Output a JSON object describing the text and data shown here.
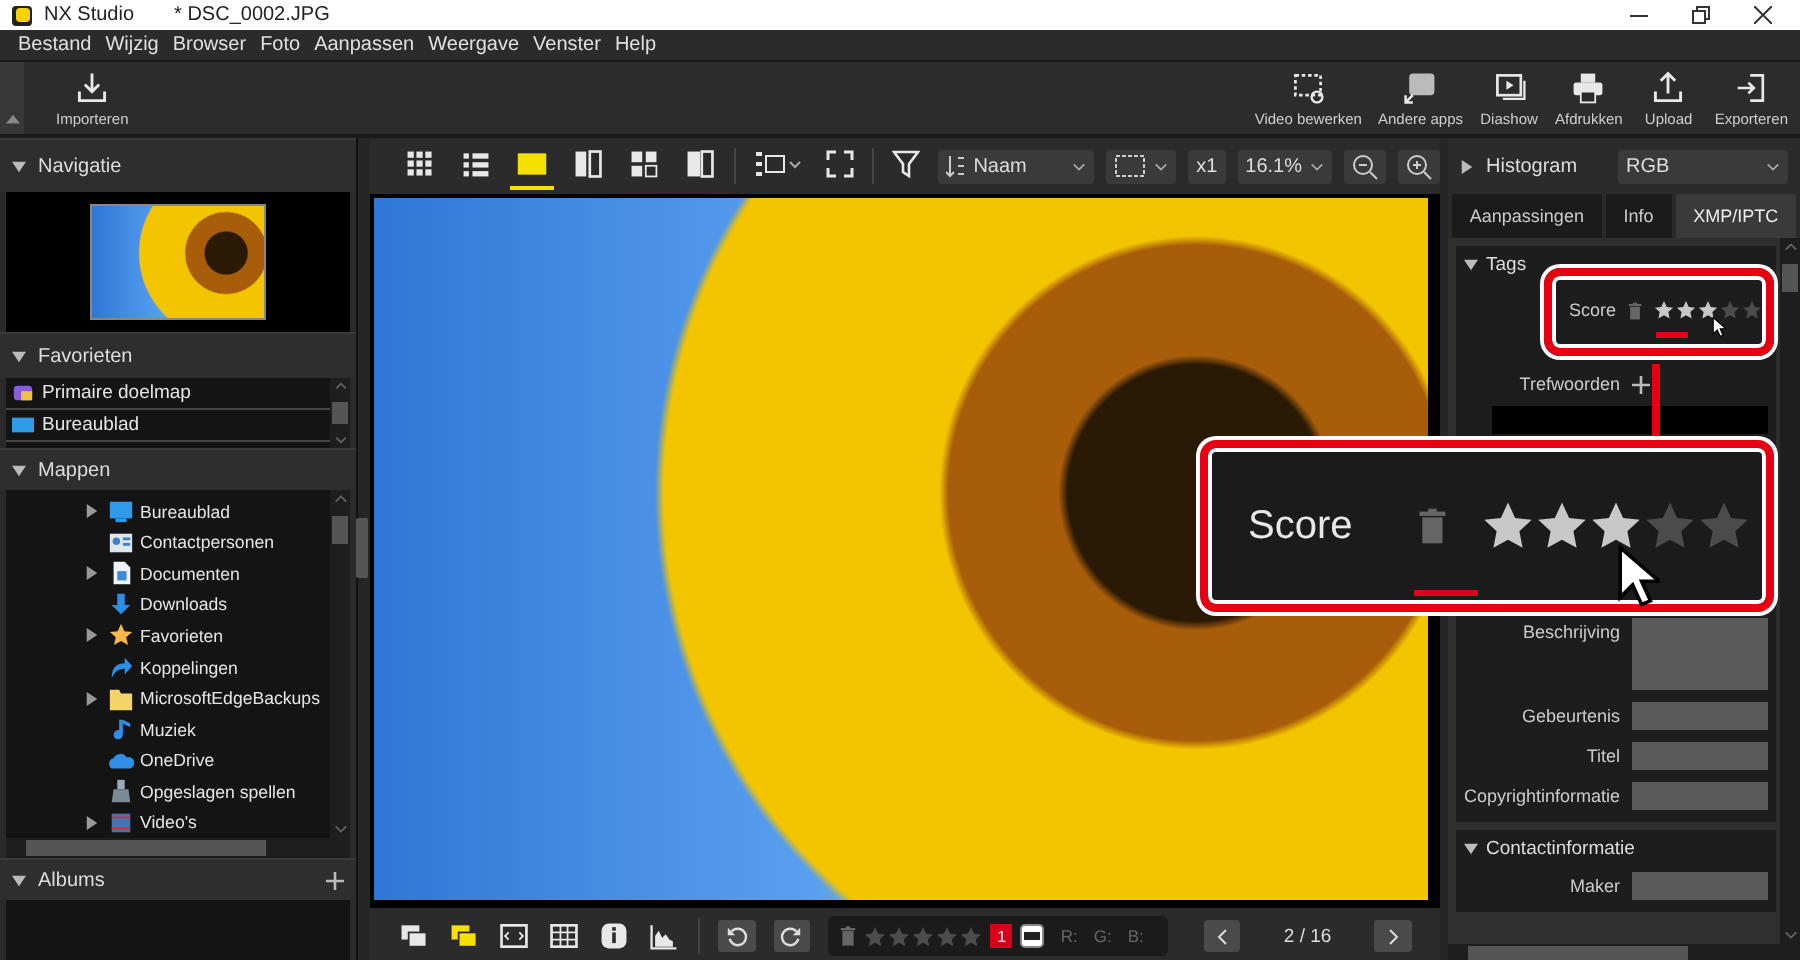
{
  "window": {
    "app_name": "NX Studio",
    "document_title": "* DSC_0002.JPG"
  },
  "menu": [
    "Bestand",
    "Wijzig",
    "Browser",
    "Foto",
    "Aanpassen",
    "Weergave",
    "Venster",
    "Help"
  ],
  "toolbar": {
    "left": [
      {
        "label": "Importeren"
      }
    ],
    "right": [
      {
        "label": "Video bewerken"
      },
      {
        "label": "Andere apps"
      },
      {
        "label": "Diashow"
      },
      {
        "label": "Afdrukken"
      },
      {
        "label": "Upload"
      },
      {
        "label": "Exporteren"
      }
    ]
  },
  "left_panel": {
    "navigatie": {
      "title": "Navigatie",
      "expanded": true
    },
    "favorieten": {
      "title": "Favorieten",
      "expanded": true,
      "items": [
        "Primaire doelmap",
        "Bureaublad"
      ]
    },
    "mappen": {
      "title": "Mappen",
      "expanded": true,
      "items": [
        {
          "label": "Bureaublad",
          "expandable": true
        },
        {
          "label": "Contactpersonen",
          "expandable": false
        },
        {
          "label": "Documenten",
          "expandable": true
        },
        {
          "label": "Downloads",
          "expandable": false
        },
        {
          "label": "Favorieten",
          "expandable": true
        },
        {
          "label": "Koppelingen",
          "expandable": false
        },
        {
          "label": "MicrosoftEdgeBackups",
          "expandable": true
        },
        {
          "label": "Muziek",
          "expandable": false
        },
        {
          "label": "OneDrive",
          "expandable": false
        },
        {
          "label": "Opgeslagen spellen",
          "expandable": false
        },
        {
          "label": "Video's",
          "expandable": true
        }
      ]
    },
    "albums": {
      "title": "Albums",
      "expanded": true
    }
  },
  "viewer_toolbar": {
    "view_modes": [
      {
        "selected": false
      },
      {
        "selected": false
      },
      {
        "selected": true
      },
      {
        "selected": false
      },
      {
        "selected": false
      },
      {
        "selected": false
      }
    ],
    "sort": "Naam",
    "zoom_factor": "x1",
    "zoom": "16.1%"
  },
  "bottom_bar": {
    "modes": [
      {
        "selected": false
      },
      {
        "selected": true
      },
      {
        "selected": false
      },
      {
        "selected": false
      },
      {
        "selected": false
      },
      {
        "selected": false
      }
    ],
    "stars": 0,
    "label": "1",
    "r": "R:",
    "g": "G:",
    "b": "B:",
    "counter": "2 / 16"
  },
  "right_panel": {
    "histogram": {
      "title": "Histogram",
      "expanded": false,
      "channel": "RGB"
    },
    "tabs": [
      {
        "label": "Aanpassingen",
        "selected": false
      },
      {
        "label": "Info",
        "selected": false
      },
      {
        "label": "XMP/IPTC",
        "selected": true
      }
    ],
    "tags": {
      "title": "Tags",
      "expanded": true,
      "score_label": "Score",
      "stars": 3,
      "keywords_label": "Trefwoorden",
      "fields": [
        {
          "label": "Beschrijving",
          "kind": "textarea"
        },
        {
          "label": "Gebeurtenis",
          "kind": "line"
        },
        {
          "label": "Titel",
          "kind": "line"
        },
        {
          "label": "Copyrightinformatie",
          "kind": "line"
        }
      ]
    },
    "contact": {
      "title": "Contactinformatie",
      "expanded": true,
      "fields": [
        {
          "label": "Maker",
          "kind": "line"
        }
      ]
    }
  },
  "callout": {
    "label": "Score",
    "stars": 3
  }
}
